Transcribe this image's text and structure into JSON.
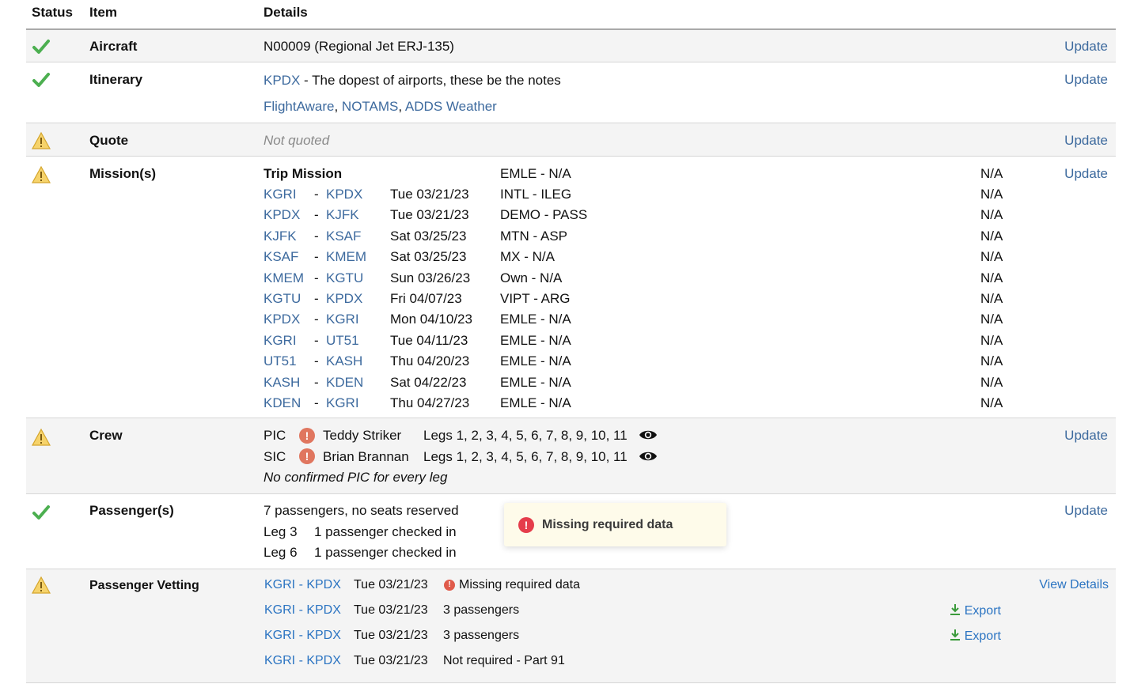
{
  "header": {
    "status": "Status",
    "item": "Item",
    "details": "Details"
  },
  "update_label": "Update",
  "aircraft": {
    "label": "Aircraft",
    "value": "N00009 (Regional Jet ERJ-135)"
  },
  "itinerary": {
    "label": "Itinerary",
    "airport": "KPDX",
    "separator": " - ",
    "notes": "The dopest of airports, these be the notes",
    "links": [
      "FlightAware",
      "NOTAMS",
      "ADDS Weather"
    ],
    "comma": ","
  },
  "quote": {
    "label": "Quote",
    "value": "Not quoted"
  },
  "missions": {
    "label": "Mission(s)",
    "title": "Trip Mission",
    "title_code": "EMLE - N/A",
    "title_na": "N/A",
    "dash": "-",
    "legs": [
      {
        "from": "KGRI",
        "to": "KPDX",
        "date": "Tue 03/21/23",
        "code": "INTL - ILEG",
        "na": "N/A"
      },
      {
        "from": "KPDX",
        "to": "KJFK",
        "date": "Tue 03/21/23",
        "code": "DEMO - PASS",
        "na": "N/A"
      },
      {
        "from": "KJFK",
        "to": "KSAF",
        "date": "Sat 03/25/23",
        "code": "MTN - ASP",
        "na": "N/A"
      },
      {
        "from": "KSAF",
        "to": "KMEM",
        "date": "Sat 03/25/23",
        "code": "MX - N/A",
        "na": "N/A"
      },
      {
        "from": "KMEM",
        "to": "KGTU",
        "date": "Sun 03/26/23",
        "code": "Own - N/A",
        "na": "N/A"
      },
      {
        "from": "KGTU",
        "to": "KPDX",
        "date": "Fri 04/07/23",
        "code": "VIPT - ARG",
        "na": "N/A"
      },
      {
        "from": "KPDX",
        "to": "KGRI",
        "date": "Mon 04/10/23",
        "code": "EMLE - N/A",
        "na": "N/A"
      },
      {
        "from": "KGRI",
        "to": "UT51",
        "date": "Tue 04/11/23",
        "code": "EMLE - N/A",
        "na": "N/A"
      },
      {
        "from": "UT51",
        "to": "KASH",
        "date": "Thu 04/20/23",
        "code": "EMLE - N/A",
        "na": "N/A"
      },
      {
        "from": "KASH",
        "to": "KDEN",
        "date": "Sat 04/22/23",
        "code": "EMLE - N/A",
        "na": "N/A"
      },
      {
        "from": "KDEN",
        "to": "KGRI",
        "date": "Thu 04/27/23",
        "code": "EMLE - N/A",
        "na": "N/A"
      }
    ]
  },
  "crew": {
    "label": "Crew",
    "members": [
      {
        "role": "PIC",
        "name": "Teddy Striker",
        "legs": "Legs 1, 2, 3, 4, 5, 6, 7, 8, 9, 10, 11"
      },
      {
        "role": "SIC",
        "name": "Brian Brannan",
        "legs": "Legs 1, 2, 3, 4, 5, 6, 7, 8, 9, 10, 11"
      }
    ],
    "note": "No confirmed PIC for every leg",
    "alert_glyph": "!"
  },
  "passengers": {
    "label": "Passenger(s)",
    "summary": "7 passengers, no seats reserved",
    "legs": [
      {
        "leg": "Leg 3",
        "text": "1 passenger checked in"
      },
      {
        "leg": "Leg 6",
        "text": "1 passenger checked in"
      }
    ]
  },
  "toast": {
    "text": "Missing required data",
    "glyph": "!"
  },
  "vetting": {
    "label": "Passenger Vetting",
    "view_details": "View Details",
    "export_label": "Export",
    "rows": [
      {
        "route": "KGRI - KPDX",
        "date": "Tue 03/21/23",
        "info": "Missing required data"
      },
      {
        "route": "KGRI - KPDX",
        "date": "Tue 03/21/23",
        "info": "3 passengers"
      },
      {
        "route": "KGRI - KPDX",
        "date": "Tue 03/21/23",
        "info": "3 passengers"
      },
      {
        "route": "KGRI - KPDX",
        "date": "Tue 03/21/23",
        "info": "Not required - Part 91"
      }
    ]
  },
  "colors": {
    "link": "#3d6a9e",
    "check": "#4caf50",
    "warning": "#f2c94c",
    "alert": "#e0765f"
  }
}
